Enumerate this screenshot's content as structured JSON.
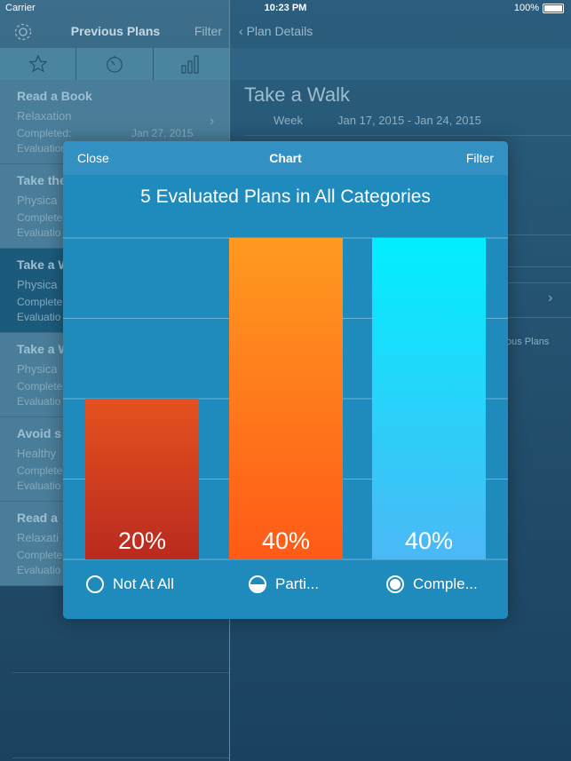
{
  "status_bar": {
    "carrier": "Carrier",
    "time": "10:23 PM",
    "battery": "100%"
  },
  "left_nav": {
    "title": "Previous Plans",
    "filter": "Filter"
  },
  "plans": [
    {
      "title": "Read a Book",
      "category": "Relaxation",
      "completed_label": "Completed:",
      "date": "Jan 27, 2015",
      "evaluation_label": "Evaluation"
    },
    {
      "title": "Take the",
      "category": "Physica",
      "completed_label": "Complete",
      "evaluation_label": "Evaluatio"
    },
    {
      "title": "Take a W",
      "category": "Physica",
      "completed_label": "Complete",
      "evaluation_label": "Evaluatio"
    },
    {
      "title": "Take a W",
      "category": "Physica",
      "completed_label": "Complete",
      "evaluation_label": "Evaluatio"
    },
    {
      "title": "Avoid s",
      "category": "Healthy",
      "completed_label": "Complete",
      "evaluation_label": "Evaluatio"
    },
    {
      "title": "Read a",
      "category": "Relaxati",
      "completed_label": "Complete",
      "evaluation_label": "Evaluatio"
    }
  ],
  "right_nav": {
    "back_label": "Plan Details"
  },
  "plan_detail": {
    "title": "Take a Walk",
    "period_label": "Week",
    "range": "Jan 17, 2015 - Jan 24, 2015",
    "previous_label": "ous Plans"
  },
  "modal": {
    "close": "Close",
    "title": "Chart",
    "filter": "Filter"
  },
  "chart_data": {
    "type": "bar",
    "title": "5 Evaluated Plans in All Categories",
    "categories": [
      "Not At All",
      "Parti...",
      "Comple..."
    ],
    "values": [
      20,
      40,
      40
    ],
    "value_labels": [
      "20%",
      "40%",
      "40%"
    ],
    "ylim": [
      0,
      40
    ],
    "grid": true,
    "legend_position": "bottom",
    "colors": [
      {
        "top": "#e5521f",
        "bottom": "#b92a1f"
      },
      {
        "top": "#ff9a21",
        "bottom": "#ff5a17"
      },
      {
        "top": "#00efff",
        "bottom": "#4cb8f5"
      }
    ]
  }
}
